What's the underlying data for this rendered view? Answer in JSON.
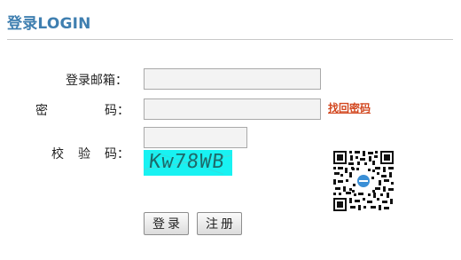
{
  "header": {
    "title": "登录LOGIN"
  },
  "form": {
    "email_label": "登录邮箱：",
    "email_value": "",
    "password_label_first": "密",
    "password_label_rest": "码：",
    "password_value": "",
    "forgot_link": "找回密码",
    "captcha_label_1": "校",
    "captcha_label_2": "验",
    "captcha_label_3": "码：",
    "captcha_value": "",
    "captcha_image_text": "Kw78WB"
  },
  "qr_code": {
    "icon": "qr-code-icon",
    "accent_color": "#3a8fd6"
  },
  "actions": {
    "login_label": "登录",
    "register_label": "注册"
  },
  "colors": {
    "title": "#3f7fb0",
    "link": "#d2461e",
    "captcha_background": "#18f2f2"
  }
}
